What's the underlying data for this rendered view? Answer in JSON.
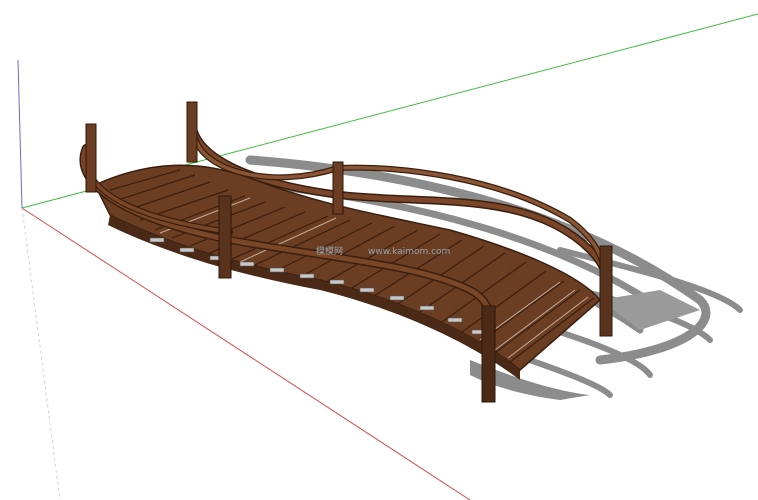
{
  "watermark": {
    "site_name": "模模网",
    "site_url": "www.kaimom.com"
  },
  "colors": {
    "background": "#ffffff",
    "axis_green": "#3fbf3f",
    "axis_red": "#d94a4a",
    "axis_blue": "#6a6ad6",
    "wood_dark": "#4a2a16",
    "wood_mid": "#6b3d22",
    "wood_light": "#8a5532",
    "shadow": "#8c8c8c"
  }
}
